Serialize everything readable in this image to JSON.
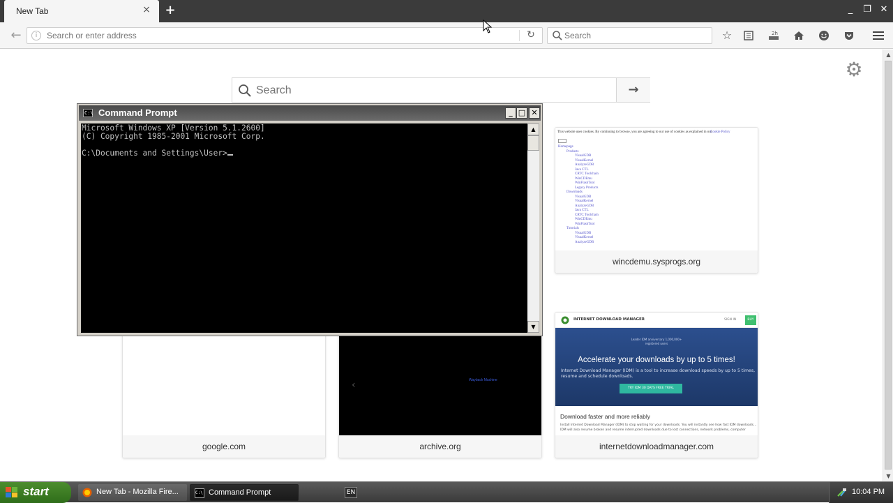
{
  "browser": {
    "tab": {
      "title": "New Tab",
      "close": "×"
    },
    "new_tab": "+",
    "window_controls": {
      "minimize": "_",
      "restore": "❐",
      "close": "✕"
    },
    "nav": {
      "back": "←",
      "address_placeholder": "Search or enter address",
      "reload": "↻",
      "search_placeholder": "Search"
    },
    "toolbar_icons": [
      "star-icon",
      "reading-list-icon",
      "downloads-icon",
      "home-icon",
      "hello-icon",
      "pocket-icon",
      "menu-icon"
    ]
  },
  "newtab": {
    "search_placeholder": "Search",
    "go": "→",
    "tiles": [
      {
        "label": "wincdemu.sysprogs.org"
      },
      {
        "label": "google.com"
      },
      {
        "label": "archive.org"
      },
      {
        "label": "internetdownloadmanager.com"
      }
    ],
    "wincdemu_thumb": {
      "notice": "This website uses cookies. By continuing to browse, you are agreeing to our use of cookies as explained in our",
      "notice_link": "Cookie Policy",
      "links": [
        "Homepage",
        "Products",
        "VisualGDB",
        "VisualKernel",
        "AnalyzeGDB",
        "Java CTL",
        "CRTC Toolchain",
        "WinCDEmu",
        "WinFlashTool",
        "Legacy Products",
        "Downloads",
        "VisualGDB",
        "VisualKernel",
        "AnalyzeGDB",
        "Java CTL",
        "CRTC Toolchain",
        "WinCDEmu",
        "WinFlashTool",
        "Tutorials",
        "VisualGDB",
        "VisualKernel",
        "AnalyzeGDB"
      ]
    },
    "idm_thumb": {
      "brand": "INTERNET DOWNLOAD MANAGER",
      "top_link": "SIGN IN",
      "badge": "BUY",
      "award": "Leader IDM anniversary 1,000,000+ registered users",
      "headline": "Accelerate your downloads by up to 5 times!",
      "sub": "Internet Download Manager (IDM) is a tool to increase download speeds by up to 5 times, resume and schedule downloads.",
      "cta": "TRY IDM 30 DAYS FREE TRIAL",
      "section": "Download faster and more reliably",
      "body": "Install Internet Download Manager (IDM) to stop waiting for your downloads. You will instantly see how fast IDM downloads... IDM will also resume broken and resume interrupted downloads due to lost connections, network problems, computer"
    },
    "archive_thumb": {
      "prev": "‹",
      "text": "Wayback Machine"
    }
  },
  "cmd": {
    "title": "Command Prompt",
    "lines": [
      "Microsoft Windows XP [Version 5.1.2600]",
      "(C) Copyright 1985-2001 Microsoft Corp.",
      "",
      "C:\\Documents and Settings\\User>"
    ],
    "buttons": {
      "minimize": "_",
      "maximize": "□",
      "close": "✕"
    }
  },
  "taskbar": {
    "start": "start",
    "tasks": [
      {
        "label": "New Tab - Mozilla Fire..."
      },
      {
        "label": "Command Prompt"
      }
    ],
    "language": "EN",
    "clock": "10:04 PM"
  }
}
